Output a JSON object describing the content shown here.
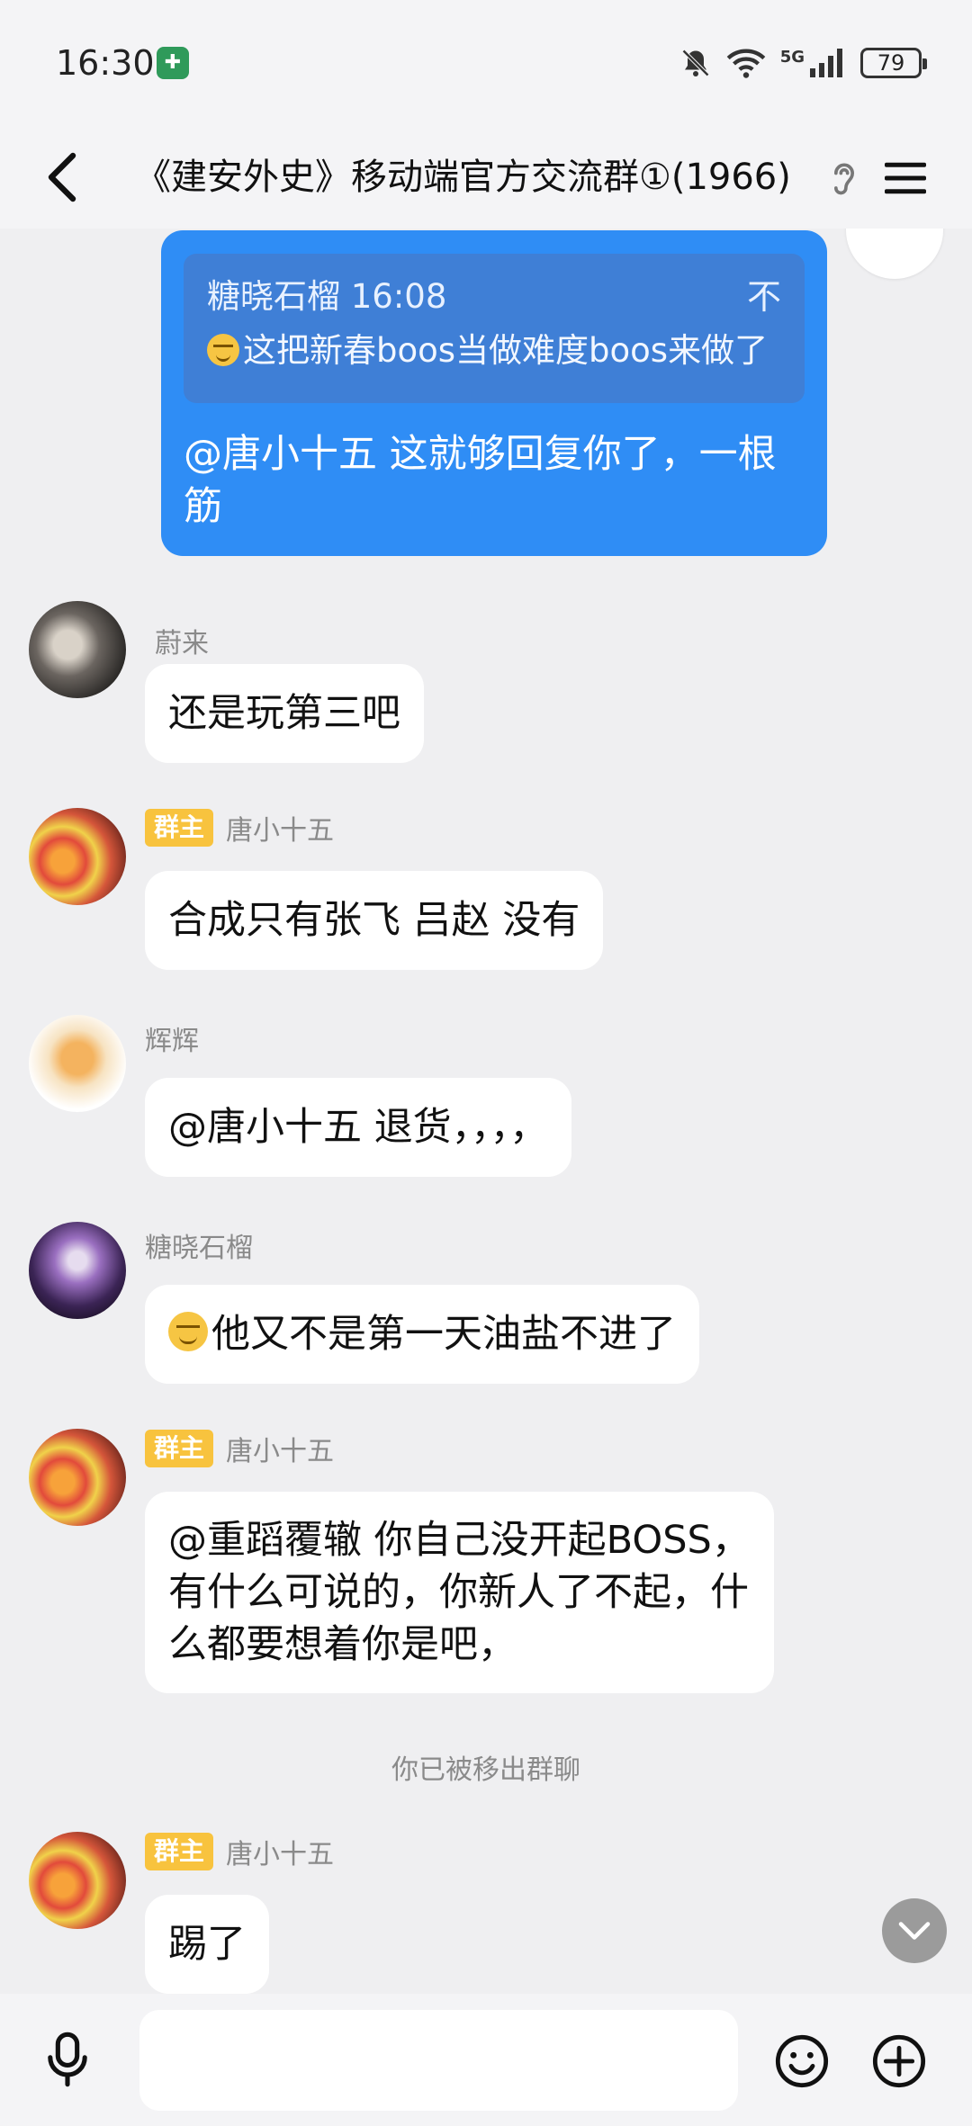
{
  "status_bar": {
    "time": "16:30",
    "network": "5G",
    "battery": "79"
  },
  "header": {
    "title": "《建安外史》移动端官方交流群①(1966)"
  },
  "messages": {
    "m0": {
      "reply_quote": {
        "author_time": "糖晓石榴 16:08",
        "text": "这把新春boos当做难度boos来做了",
        "arrow": "不"
      },
      "text_line1": "@唐小十五 这就够回复你了，一根",
      "text_line2": "筋"
    },
    "m1": {
      "sender": "蔚来",
      "text": "还是玩第三吧"
    },
    "m2": {
      "badge": "群主",
      "sender": "唐小十五",
      "text": "合成只有张飞 吕赵 没有"
    },
    "m3": {
      "sender": "辉辉",
      "text": "@唐小十五 退货，，，，"
    },
    "m4": {
      "sender": "糖晓石榴",
      "text": "他又不是第一天油盐不进了"
    },
    "m5": {
      "badge": "群主",
      "sender": "唐小十五",
      "line1": "@重蹈覆辙 你自己没开起BOSS，",
      "line2": "有什么可说的，你新人了不起，什",
      "line3": "么都要想着你是吧，"
    },
    "system_note": "你已被移出群聊",
    "m6": {
      "badge": "群主",
      "sender": "唐小十五",
      "text": "踢了"
    }
  },
  "colors": {
    "my_bubble": "#2f8df5",
    "owner_badge": "#f8c33e",
    "background": "#efeff1"
  }
}
